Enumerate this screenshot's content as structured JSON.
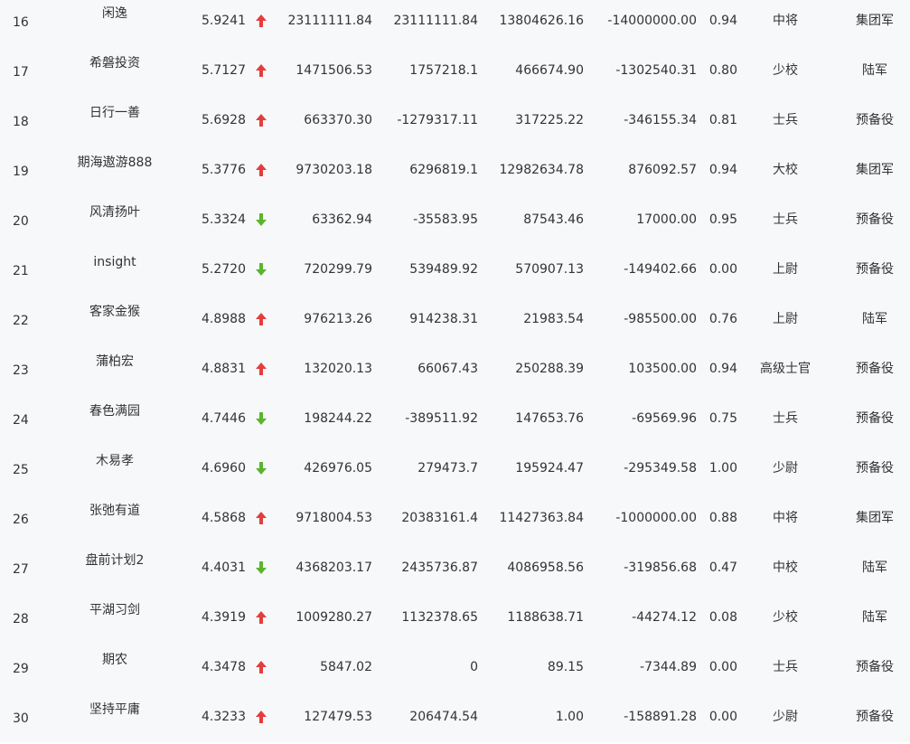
{
  "colors": {
    "up": "#e43d3d",
    "down": "#5ab52d",
    "text": "#333333",
    "background": "#f7f8fa"
  },
  "rows": [
    {
      "rank": "16",
      "name": "闲逸",
      "score": "5.9241",
      "trend": "up",
      "v1": "23111111.84",
      "v2": "23111111.84",
      "v3": "13804626.16",
      "v4": "-14000000.00",
      "ratio": "0.94",
      "military_rank": "中将",
      "army": "集团军"
    },
    {
      "rank": "17",
      "name": "希磐投资",
      "score": "5.7127",
      "trend": "up",
      "v1": "1471506.53",
      "v2": "1757218.1",
      "v3": "466674.90",
      "v4": "-1302540.31",
      "ratio": "0.80",
      "military_rank": "少校",
      "army": "陆军"
    },
    {
      "rank": "18",
      "name": "日行一善",
      "score": "5.6928",
      "trend": "up",
      "v1": "663370.30",
      "v2": "-1279317.11",
      "v3": "317225.22",
      "v4": "-346155.34",
      "ratio": "0.81",
      "military_rank": "士兵",
      "army": "预备役"
    },
    {
      "rank": "19",
      "name": "期海遨游888",
      "score": "5.3776",
      "trend": "up",
      "v1": "9730203.18",
      "v2": "6296819.1",
      "v3": "12982634.78",
      "v4": "876092.57",
      "ratio": "0.94",
      "military_rank": "大校",
      "army": "集团军"
    },
    {
      "rank": "20",
      "name": "风清扬叶",
      "score": "5.3324",
      "trend": "down",
      "v1": "63362.94",
      "v2": "-35583.95",
      "v3": "87543.46",
      "v4": "17000.00",
      "ratio": "0.95",
      "military_rank": "士兵",
      "army": "预备役"
    },
    {
      "rank": "21",
      "name": "insight",
      "score": "5.2720",
      "trend": "down",
      "v1": "720299.79",
      "v2": "539489.92",
      "v3": "570907.13",
      "v4": "-149402.66",
      "ratio": "0.00",
      "military_rank": "上尉",
      "army": "预备役"
    },
    {
      "rank": "22",
      "name": "客家金猴",
      "score": "4.8988",
      "trend": "up",
      "v1": "976213.26",
      "v2": "914238.31",
      "v3": "21983.54",
      "v4": "-985500.00",
      "ratio": "0.76",
      "military_rank": "上尉",
      "army": "陆军"
    },
    {
      "rank": "23",
      "name": "蒲柏宏",
      "score": "4.8831",
      "trend": "up",
      "v1": "132020.13",
      "v2": "66067.43",
      "v3": "250288.39",
      "v4": "103500.00",
      "ratio": "0.94",
      "military_rank": "高级士官",
      "army": "预备役"
    },
    {
      "rank": "24",
      "name": "春色满园",
      "score": "4.7446",
      "trend": "down",
      "v1": "198244.22",
      "v2": "-389511.92",
      "v3": "147653.76",
      "v4": "-69569.96",
      "ratio": "0.75",
      "military_rank": "士兵",
      "army": "预备役"
    },
    {
      "rank": "25",
      "name": "木易孝",
      "score": "4.6960",
      "trend": "down",
      "v1": "426976.05",
      "v2": "279473.7",
      "v3": "195924.47",
      "v4": "-295349.58",
      "ratio": "1.00",
      "military_rank": "少尉",
      "army": "预备役"
    },
    {
      "rank": "26",
      "name": "张弛有道",
      "score": "4.5868",
      "trend": "up",
      "v1": "9718004.53",
      "v2": "20383161.4",
      "v3": "11427363.84",
      "v4": "-1000000.00",
      "ratio": "0.88",
      "military_rank": "中将",
      "army": "集团军"
    },
    {
      "rank": "27",
      "name": "盘前计划2",
      "score": "4.4031",
      "trend": "down",
      "v1": "4368203.17",
      "v2": "2435736.87",
      "v3": "4086958.56",
      "v4": "-319856.68",
      "ratio": "0.47",
      "military_rank": "中校",
      "army": "陆军"
    },
    {
      "rank": "28",
      "name": "平湖习剑",
      "score": "4.3919",
      "trend": "up",
      "v1": "1009280.27",
      "v2": "1132378.65",
      "v3": "1188638.71",
      "v4": "-44274.12",
      "ratio": "0.08",
      "military_rank": "少校",
      "army": "陆军"
    },
    {
      "rank": "29",
      "name": "期农",
      "score": "4.3478",
      "trend": "up",
      "v1": "5847.02",
      "v2": "0",
      "v3": "89.15",
      "v4": "-7344.89",
      "ratio": "0.00",
      "military_rank": "士兵",
      "army": "预备役"
    },
    {
      "rank": "30",
      "name": "坚持平庸",
      "score": "4.3233",
      "trend": "up",
      "v1": "127479.53",
      "v2": "206474.54",
      "v3": "1.00",
      "v4": "-158891.28",
      "ratio": "0.00",
      "military_rank": "少尉",
      "army": "预备役"
    }
  ]
}
